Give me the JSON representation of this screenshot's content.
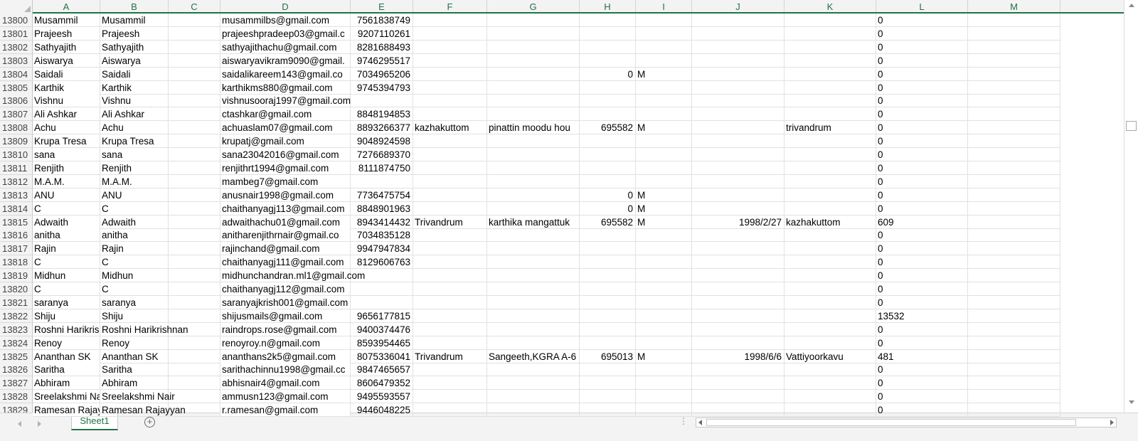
{
  "sheet": {
    "tab_label": "Sheet1",
    "accent_color": "#217346"
  },
  "columns": [
    "A",
    "B",
    "C",
    "D",
    "E",
    "F",
    "G",
    "H",
    "I",
    "J",
    "K",
    "L",
    "M"
  ],
  "rows": [
    {
      "n": "13800",
      "A": "Musammil",
      "B": "Musammil",
      "C": "",
      "D": "musammilbs@gmail.com",
      "E": "7561838749",
      "F": "",
      "G": "",
      "H": "",
      "I": "",
      "J": "",
      "K": "",
      "L": "0"
    },
    {
      "n": "13801",
      "A": "Prajeesh",
      "B": "Prajeesh",
      "C": "",
      "D": "prajeeshpradeep03@gmail.c",
      "E": "9207110261",
      "F": "",
      "G": "",
      "H": "",
      "I": "",
      "J": "",
      "K": "",
      "L": "0"
    },
    {
      "n": "13802",
      "A": "Sathyajith",
      "B": "Sathyajith",
      "C": "",
      "D": "sathyajithachu@gmail.com",
      "E": "8281688493",
      "F": "",
      "G": "",
      "H": "",
      "I": "",
      "J": "",
      "K": "",
      "L": "0"
    },
    {
      "n": "13803",
      "A": "Aiswarya",
      "B": "Aiswarya",
      "C": "",
      "D": "aiswaryavikram9090@gmail.",
      "E": "9746295517",
      "F": "",
      "G": "",
      "H": "",
      "I": "",
      "J": "",
      "K": "",
      "L": "0"
    },
    {
      "n": "13804",
      "A": "Saidali",
      "B": "Saidali",
      "C": "",
      "D": "saidalikareem143@gmail.co",
      "E": "7034965206",
      "F": "",
      "G": "",
      "H": "0",
      "I": "M",
      "J": "",
      "K": "",
      "L": "0"
    },
    {
      "n": "13805",
      "A": "Karthik",
      "B": "Karthik",
      "C": "",
      "D": "karthikms880@gmail.com",
      "E": "9745394793",
      "F": "",
      "G": "",
      "H": "",
      "I": "",
      "J": "",
      "K": "",
      "L": "0"
    },
    {
      "n": "13806",
      "A": "Vishnu",
      "B": "Vishnu",
      "C": "",
      "D": "vishnusooraj1997@gmail.com",
      "E": "",
      "F": "",
      "G": "",
      "H": "",
      "I": "",
      "J": "",
      "K": "",
      "L": "0"
    },
    {
      "n": "13807",
      "A": "Ali Ashkar",
      "B": "Ali Ashkar",
      "C": "",
      "D": "ctashkar@gmail.com",
      "E": "8848194853",
      "F": "",
      "G": "",
      "H": "",
      "I": "",
      "J": "",
      "K": "",
      "L": "0"
    },
    {
      "n": "13808",
      "A": "Achu",
      "B": "Achu",
      "C": "",
      "D": "achuaslam07@gmail.com",
      "E": "8893266377",
      "F": "kazhakuttom",
      "G": "pinattin moodu hou",
      "H": "695582",
      "I": "M",
      "J": "",
      "K": "trivandrum",
      "L": "0"
    },
    {
      "n": "13809",
      "A": "Krupa Tresa",
      "B": "Krupa Tresa",
      "C": "",
      "D": "krupatj@gmail.com",
      "E": "9048924598",
      "F": "",
      "G": "",
      "H": "",
      "I": "",
      "J": "",
      "K": "",
      "L": "0"
    },
    {
      "n": "13810",
      "A": "sana",
      "B": "sana",
      "C": "",
      "D": "sana23042016@gmail.com",
      "E": "7276689370",
      "F": "",
      "G": "",
      "H": "",
      "I": "",
      "J": "",
      "K": "",
      "L": "0"
    },
    {
      "n": "13811",
      "A": "Renjith",
      "B": "Renjith",
      "C": "",
      "D": "renjithrt1994@gmail.com",
      "E": "8111874750",
      "F": "",
      "G": "",
      "H": "",
      "I": "",
      "J": "",
      "K": "",
      "L": "0"
    },
    {
      "n": "13812",
      "A": "M.A.M.",
      "B": "M.A.M.",
      "C": "",
      "D": "mambeg7@gmail.com",
      "E": "",
      "F": "",
      "G": "",
      "H": "",
      "I": "",
      "J": "",
      "K": "",
      "L": "0"
    },
    {
      "n": "13813",
      "A": "ANU",
      "B": "ANU",
      "C": "",
      "D": "anusnair1998@gmail.com",
      "E": "7736475754",
      "F": "",
      "G": "",
      "H": "0",
      "I": "M",
      "J": "",
      "K": "",
      "L": "0"
    },
    {
      "n": "13814",
      "A": "C",
      "B": "C",
      "C": "",
      "D": "chaithanyagj113@gmail.com",
      "E": "8848901963",
      "F": "",
      "G": "",
      "H": "0",
      "I": "M",
      "J": "",
      "K": "",
      "L": "0"
    },
    {
      "n": "13815",
      "A": "Adwaith",
      "B": "Adwaith",
      "C": "",
      "D": "adwaithachu01@gmail.com",
      "E": "8943414432",
      "F": "Trivandrum",
      "G": "karthika mangattuk",
      "H": "695582",
      "I": "M",
      "J": "1998/2/27",
      "K": "kazhakuttom",
      "L": "609"
    },
    {
      "n": "13816",
      "A": "anitha",
      "B": "anitha",
      "C": "",
      "D": "anitharenjithrnair@gmail.co",
      "E": "7034835128",
      "F": "",
      "G": "",
      "H": "",
      "I": "",
      "J": "",
      "K": "",
      "L": "0"
    },
    {
      "n": "13817",
      "A": "Rajin",
      "B": "Rajin",
      "C": "",
      "D": "rajinchand@gmail.com",
      "E": "9947947834",
      "F": "",
      "G": "",
      "H": "",
      "I": "",
      "J": "",
      "K": "",
      "L": "0"
    },
    {
      "n": "13818",
      "A": "C",
      "B": "C",
      "C": "",
      "D": "chaithanyagj111@gmail.com",
      "E": "8129606763",
      "F": "",
      "G": "",
      "H": "",
      "I": "",
      "J": "",
      "K": "",
      "L": "0"
    },
    {
      "n": "13819",
      "A": "Midhun",
      "B": "Midhun",
      "C": "",
      "D": "midhunchandran.ml1@gmail.com",
      "E": "",
      "F": "",
      "G": "",
      "H": "",
      "I": "",
      "J": "",
      "K": "",
      "L": "0"
    },
    {
      "n": "13820",
      "A": "C",
      "B": "C",
      "C": "",
      "D": "chaithanyagj112@gmail.com",
      "E": "",
      "F": "",
      "G": "",
      "H": "",
      "I": "",
      "J": "",
      "K": "",
      "L": "0"
    },
    {
      "n": "13821",
      "A": "saranya",
      "B": "saranya",
      "C": "",
      "D": "saranyajkrish001@gmail.com",
      "E": "",
      "F": "",
      "G": "",
      "H": "",
      "I": "",
      "J": "",
      "K": "",
      "L": "0"
    },
    {
      "n": "13822",
      "A": "Shiju",
      "B": "Shiju",
      "C": "",
      "D": "shijusmails@gmail.com",
      "E": "9656177815",
      "F": "",
      "G": "",
      "H": "",
      "I": "",
      "J": "",
      "K": "",
      "L": "13532"
    },
    {
      "n": "13823",
      "A": "Roshni Harikris",
      "B": "Roshni Harikrishnan",
      "C": "",
      "D": "raindrops.rose@gmail.com",
      "E": "9400374476",
      "F": "",
      "G": "",
      "H": "",
      "I": "",
      "J": "",
      "K": "",
      "L": "0"
    },
    {
      "n": "13824",
      "A": "Renoy",
      "B": "Renoy",
      "C": "",
      "D": "renoyroy.n@gmail.com",
      "E": "8593954465",
      "F": "",
      "G": "",
      "H": "",
      "I": "",
      "J": "",
      "K": "",
      "L": "0"
    },
    {
      "n": "13825",
      "A": "Ananthan SK",
      "B": "Ananthan SK",
      "C": "",
      "D": "ananthans2k5@gmail.com",
      "E": "8075336041",
      "F": "Trivandrum",
      "G": "Sangeeth,KGRA A-6",
      "H": "695013",
      "I": "M",
      "J": "1998/6/6",
      "K": "Vattiyoorkavu",
      "L": "481"
    },
    {
      "n": "13826",
      "A": "Saritha",
      "B": "Saritha",
      "C": "",
      "D": "sarithachinnu1998@gmail.cc",
      "E": "9847465657",
      "F": "",
      "G": "",
      "H": "",
      "I": "",
      "J": "",
      "K": "",
      "L": "0"
    },
    {
      "n": "13827",
      "A": "Abhiram",
      "B": "Abhiram",
      "C": "",
      "D": "abhisnair4@gmail.com",
      "E": "8606479352",
      "F": "",
      "G": "",
      "H": "",
      "I": "",
      "J": "",
      "K": "",
      "L": "0"
    },
    {
      "n": "13828",
      "A": "Sreelakshmi Na",
      "B": "Sreelakshmi Nair",
      "C": "",
      "D": "ammusn123@gmail.com",
      "E": "9495593557",
      "F": "",
      "G": "",
      "H": "",
      "I": "",
      "J": "",
      "K": "",
      "L": "0"
    },
    {
      "n": "13829",
      "A": "Ramesan Rajay",
      "B": "Ramesan Rajayyan",
      "C": "",
      "D": "r.ramesan@gmail.com",
      "E": "9446048225",
      "F": "",
      "G": "",
      "H": "",
      "I": "",
      "J": "",
      "K": "",
      "L": "0"
    }
  ],
  "icons": {
    "add_sheet": "plus-circle-icon",
    "tab_nav_left": "chevron-left-icon",
    "tab_nav_right": "chevron-right-icon",
    "options": "more-vertical-icon"
  }
}
